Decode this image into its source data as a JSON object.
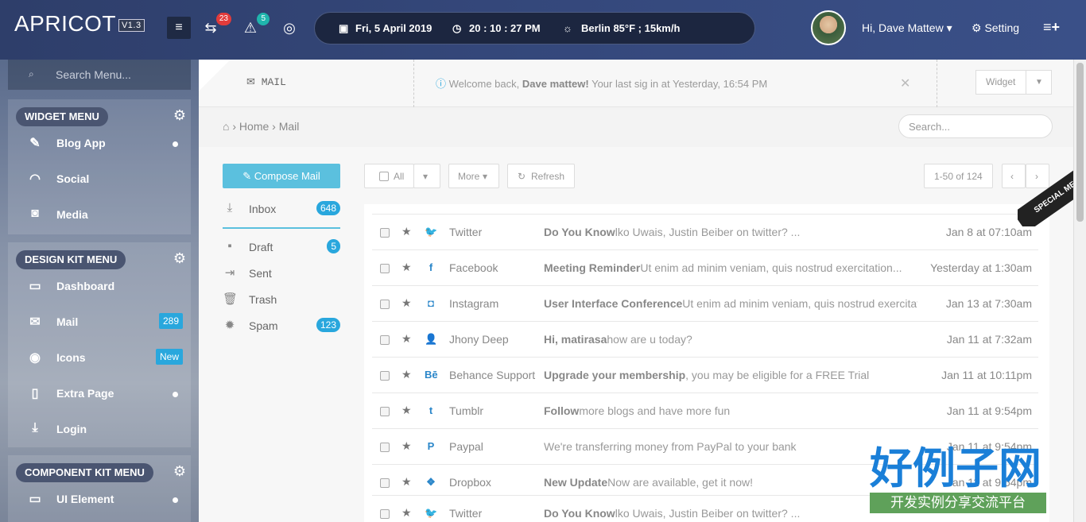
{
  "topbar": {
    "brand": "APRICOT",
    "version": "V1.3",
    "messages_badge": "23",
    "alerts_badge": "5",
    "date": "Fri, 5 April 2019",
    "time": "20 : 10 : 27 PM",
    "weather": "Berlin  85°F ; 15km/h",
    "user": "Hi, Dave Mattew ▾",
    "setting": "Setting"
  },
  "sidebar": {
    "search_placeholder": "Search Menu...",
    "widget_menu": {
      "title": "WIDGET MENU",
      "items": [
        {
          "label": "Blog App"
        },
        {
          "label": "Social"
        },
        {
          "label": "Media"
        }
      ]
    },
    "design_kit_menu": {
      "title": "DESIGN KIT MENU",
      "items": [
        {
          "label": "Dashboard"
        },
        {
          "label": "Mail",
          "badge": "289"
        },
        {
          "label": "Icons",
          "badge": "New"
        },
        {
          "label": "Extra Page"
        },
        {
          "label": "Login"
        }
      ]
    },
    "component_kit_menu": {
      "title": "COMPONENT KIT MENU",
      "items": [
        {
          "label": "UI Element"
        }
      ]
    }
  },
  "header": {
    "section_title": "MAIL",
    "welcome_prefix": "Welcome back,",
    "welcome_name": "Dave mattew!",
    "welcome_suffix": "Your last sig in at Yesterday, 16:54 PM",
    "widget_button": "Widget",
    "breadcrumb_home": "Home",
    "breadcrumb_current": "Mail",
    "search_placeholder": "Search..."
  },
  "mail": {
    "compose_label": "Compose Mail",
    "folders": [
      {
        "label": "Inbox",
        "count": "648"
      },
      {
        "label": "Draft",
        "count": "5"
      },
      {
        "label": "Sent"
      },
      {
        "label": "Trash"
      },
      {
        "label": "Spam",
        "count": "123"
      }
    ],
    "toolbar": {
      "all": "All",
      "more": "More",
      "refresh": "Refresh",
      "pagination": "1-50 of 124"
    },
    "ribbon": "SPECIAL MENTION",
    "rows": [
      {
        "from": "Twitter",
        "subject_bold": "Do You Know",
        "subject": "lko Uwais, Justin Beiber on twitter? ...",
        "date": "Jan 8 at 07:10am"
      },
      {
        "from": "Facebook",
        "subject_bold": "Meeting Reminder",
        "subject": "Ut enim ad minim veniam, quis nostrud exercitation...",
        "date": "Yesterday at 1:30am"
      },
      {
        "from": "Instagram",
        "subject_bold": "User Interface Conference",
        "subject": "Ut enim ad minim veniam, quis nostrud exercitation...",
        "date": "Jan 13 at 7:30am"
      },
      {
        "from": "Jhony Deep",
        "subject_bold": "Hi, matirasa",
        "subject": "how are u today?",
        "date": "Jan 11 at 7:32am"
      },
      {
        "from": "Behance Support",
        "subject_bold": "Upgrade your membership",
        "subject": ", you may be eligible for a FREE Trial",
        "date": "Jan 11 at 10:11pm"
      },
      {
        "from": "Tumblr",
        "subject_bold": "Follow",
        "subject": "more blogs and have more fun",
        "date": "Jan 11 at 9:54pm"
      },
      {
        "from": "Paypal",
        "subject_bold": "",
        "subject": "We're transferring money from PayPal to your bank",
        "date": "Jan 11 at 9:54pm"
      },
      {
        "from": "Dropbox",
        "subject_bold": "New Update",
        "subject": "Now are available, get it now!",
        "date": "Jan 11 at 9:54pm"
      },
      {
        "from": "Twitter",
        "subject_bold": "Do You Know",
        "subject": "lko Uwais, Justin Beiber on twitter? ...",
        "date": ""
      }
    ]
  },
  "watermark": {
    "main": "好例子网",
    "sub": "开发实例分享交流平台"
  }
}
